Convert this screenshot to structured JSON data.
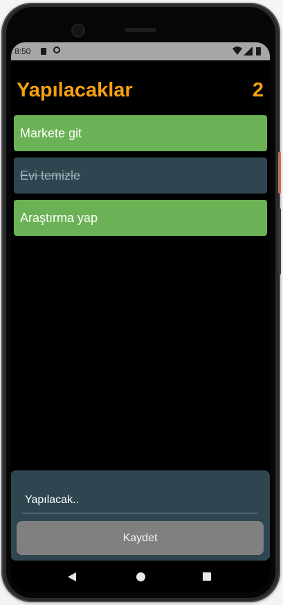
{
  "status_bar": {
    "time": "8:50"
  },
  "header": {
    "title": "Yapılacaklar",
    "count": "2"
  },
  "todos": [
    {
      "text": "Markete git",
      "done": false
    },
    {
      "text": "Evi temizle",
      "done": true
    },
    {
      "text": "Araştırma yap",
      "done": false
    }
  ],
  "form": {
    "input_value": "Yapılacak..",
    "save_label": "Kaydet"
  },
  "colors": {
    "accent": "#f5a010",
    "active_item": "#6ab255",
    "done_item": "#2f4650",
    "panel": "#2f4650",
    "button": "#808080"
  }
}
